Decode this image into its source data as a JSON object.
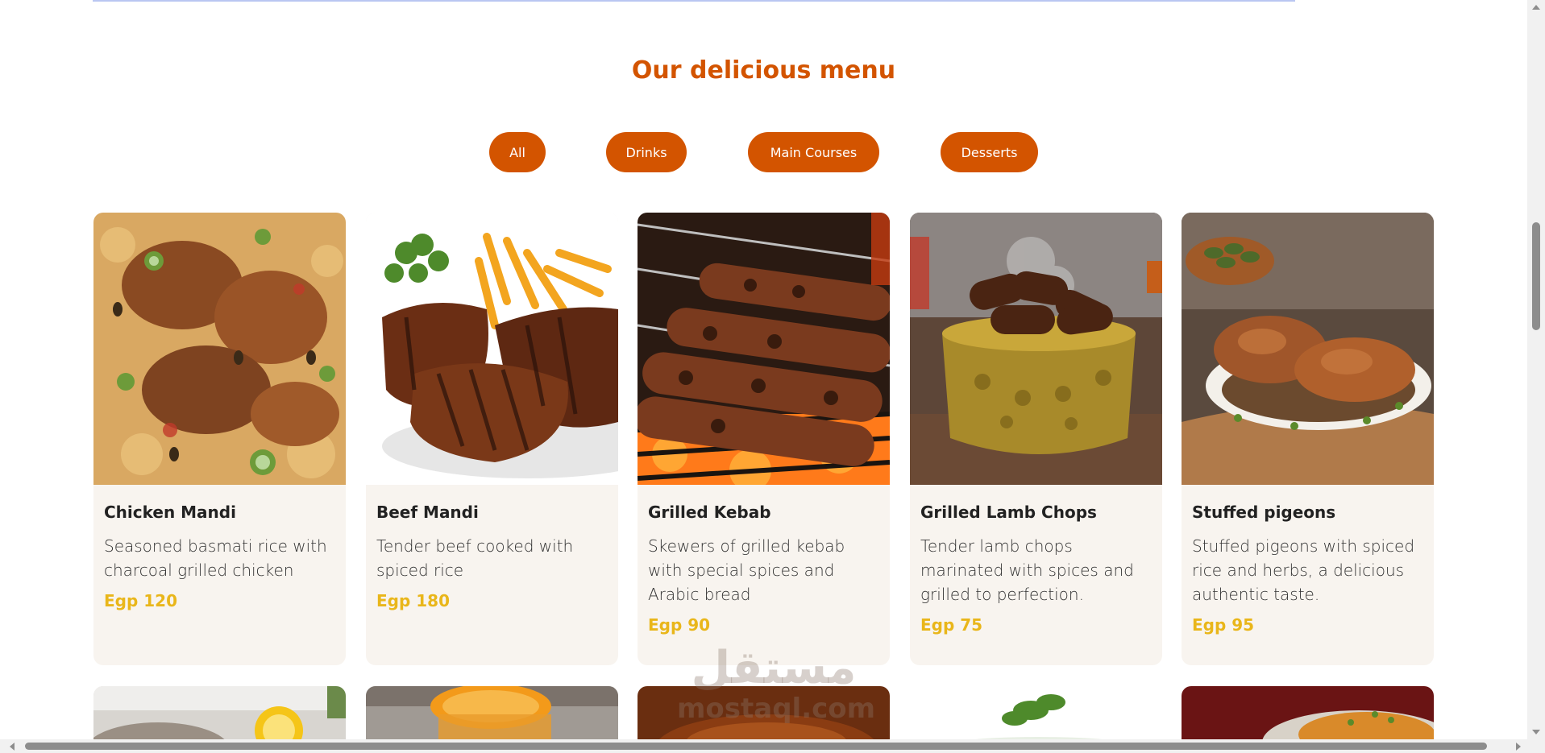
{
  "menu": {
    "title": "Our delicious menu",
    "filters": [
      "All",
      "Drinks",
      "Main Courses",
      "Desserts"
    ],
    "items": [
      {
        "name": "Chicken Mandi",
        "description": "Seasoned basmati rice with charcoal grilled chicken",
        "price": "Egp 120"
      },
      {
        "name": "Beef Mandi",
        "description": "Tender beef cooked with spiced rice",
        "price": "Egp 180"
      },
      {
        "name": "Grilled Kebab",
        "description": "Skewers of grilled kebab with special spices and Arabic bread",
        "price": "Egp 90"
      },
      {
        "name": "Grilled Lamb Chops",
        "description": "Tender lamb chops marinated with spices and grilled to perfection.",
        "price": "Egp 75"
      },
      {
        "name": "Stuffed pigeons",
        "description": "Stuffed pigeons with spiced rice and herbs, a delicious authentic taste.",
        "price": "Egp 95"
      }
    ]
  },
  "colors": {
    "accent": "#d35400",
    "price": "#e9b61a",
    "card_bg": "#f8f4ef"
  },
  "watermark": {
    "arabic": "مستقل",
    "latin": "mostaql.com"
  }
}
